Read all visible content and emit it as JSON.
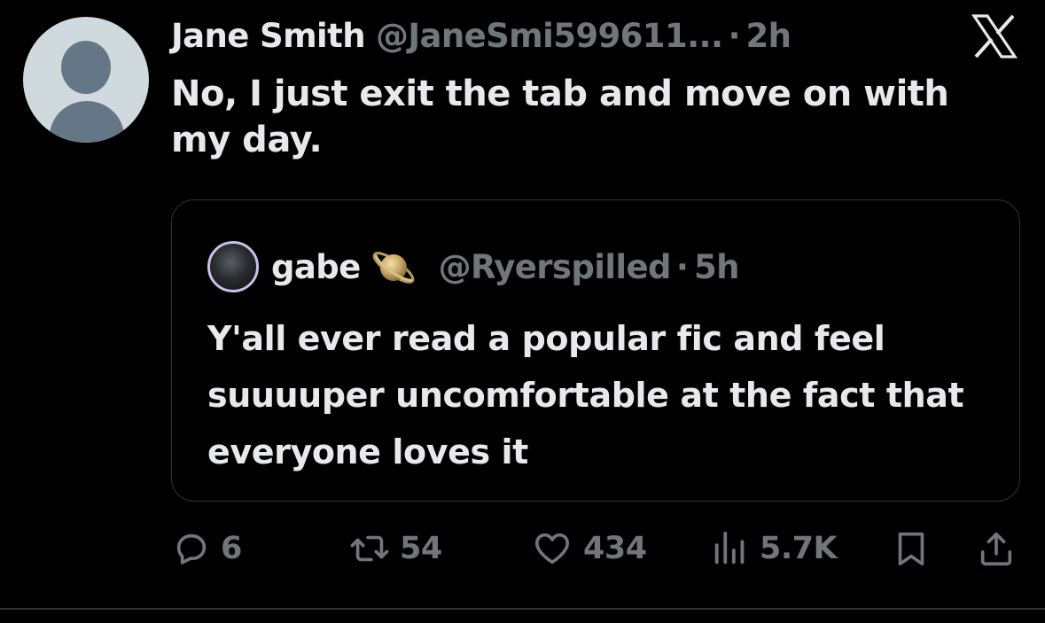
{
  "post": {
    "display_name": "Jane Smith",
    "handle": "@JaneSmi599611...",
    "separator": "·",
    "time": "2h",
    "text": "No, I just exit the tab and move on with my day."
  },
  "quoted": {
    "display_name": "gabe",
    "handle": "@Ryerspilled",
    "separator": "·",
    "time": "5h",
    "text": "Y'all ever read a popular fic and feel suuuuper uncomfortable at the fact that everyone loves it"
  },
  "actions": {
    "replies": "6",
    "reposts": "54",
    "likes": "434",
    "views": "5.7K"
  },
  "icons": {
    "logo": "x-logo-icon",
    "badge": "saturn-icon",
    "reply": "reply-icon",
    "repost": "repost-icon",
    "like": "heart-icon",
    "views": "views-icon",
    "bookmark": "bookmark-icon",
    "share": "share-icon"
  },
  "colors": {
    "background": "#000000",
    "text_primary": "#e7e9ea",
    "text_secondary": "#71767b",
    "border": "#2f3336"
  }
}
